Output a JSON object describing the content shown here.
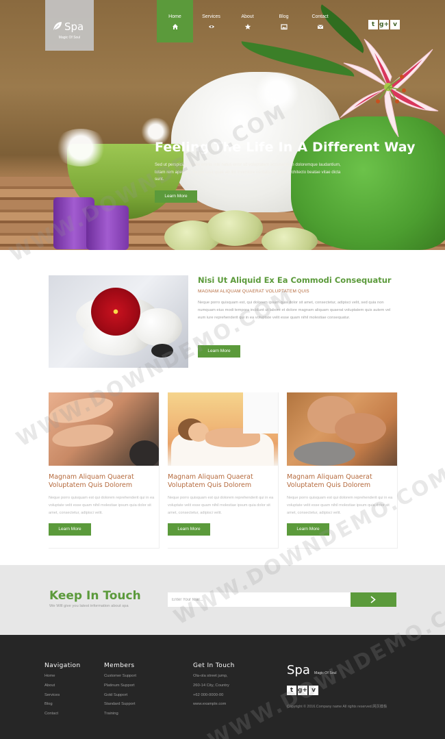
{
  "brand": {
    "name": "Spa",
    "tagline": "Magic Of Soul"
  },
  "nav": {
    "items": [
      {
        "label": "Home",
        "icon": "home-icon",
        "active": true
      },
      {
        "label": "Services",
        "icon": "eye-icon",
        "active": false
      },
      {
        "label": "About",
        "icon": "star-icon",
        "active": false
      },
      {
        "label": "Blog",
        "icon": "picture-icon",
        "active": false
      },
      {
        "label": "Contact",
        "icon": "envelope-icon",
        "active": false
      }
    ]
  },
  "social": {
    "twitter": "t",
    "google": "g+",
    "vimeo": "v"
  },
  "hero": {
    "title": "Feeling The Life In A Different Way",
    "text": "Sed ut perspiciatis unde omnis iste natus error sit voluptatem accusantium doloremque laudantium, totam rem aperiam, eaque ipsa quae ab illo inventore veritatis et quasi architecto beatae vitae dicta sunt.",
    "button": "Learn More"
  },
  "feature": {
    "title": "Nisi Ut Aliquid Ex Ea Commodi Consequatur",
    "subtitle": "MAGNAM ALIQUAM QUAERAT VOLUPTATEM QUIS",
    "text": "Neque porro quisquam est, qui dolorem ipsum quia dolor sit amet, consectetur, adipisci velit, sed quia non numquam eius modi tempora incidunt ut labore et dolore magnam aliquam quaerat voluptatem quis autem vel eum iure reprehenderit qui in ea voluptate velit esse quam nihil molestiae consequatur.",
    "button": "Learn More"
  },
  "cards": [
    {
      "title": "Magnam Aliquam Quaerat Voluptatem Quis Dolorem",
      "text": "Neque porro quisquam est qui dolorem reprehenderit qui in ea voluptate velit esse quam nihil molestiae ipsum quia dolor sit amet, consectetur, adipisci velit.",
      "button": "Learn More"
    },
    {
      "title": "Magnam Aliquam Quaerat Voluptatem Quis Dolorem",
      "text": "Neque porro quisquam est qui dolorem reprehenderit qui in ea voluptate velit esse quam nihil molestiae ipsum quia dolor sit amet, consectetur, adipisci velit.",
      "button": "Learn More"
    },
    {
      "title": "Magnam Aliquam Quaerat Voluptatem Quis Dolorem",
      "text": "Neque porro quisquam est qui dolorem reprehenderit qui in ea voluptate velit esse quam nihil molestiae ipsum quia dolor sit amet, consectetur, adipisci velit.",
      "button": "Learn More"
    }
  ],
  "newsletter": {
    "title": "Keep In Touch",
    "subtitle": "We Will give you latest information about spa",
    "placeholder": "Enter Your Mail..."
  },
  "footer": {
    "navigation": {
      "title": "Navigation",
      "links": [
        "Home",
        "About",
        "Services",
        "Blog",
        "Contact"
      ]
    },
    "members": {
      "title": "Members",
      "links": [
        "Customer Support",
        "Platinum Support",
        "Gold Support",
        "Standard Support",
        "Training"
      ]
    },
    "contact": {
      "title": "Get In Touch",
      "lines": [
        "Ola-ola street jump,",
        "260-14 City, Country",
        "+62 000-0000-00",
        "www.example.com"
      ]
    },
    "brand": "Spa",
    "tagline": "Magic Of Soul",
    "copyright": "Copyright © 2016.Company name All rights reserved.网页模板"
  },
  "watermark": "WWW.DOWNDEMO.COM",
  "colors": {
    "accent": "#5b9a3b",
    "title_brown": "#b56a3d",
    "footer_bg": "#262626",
    "newsletter_bg": "#e7e7e7"
  }
}
